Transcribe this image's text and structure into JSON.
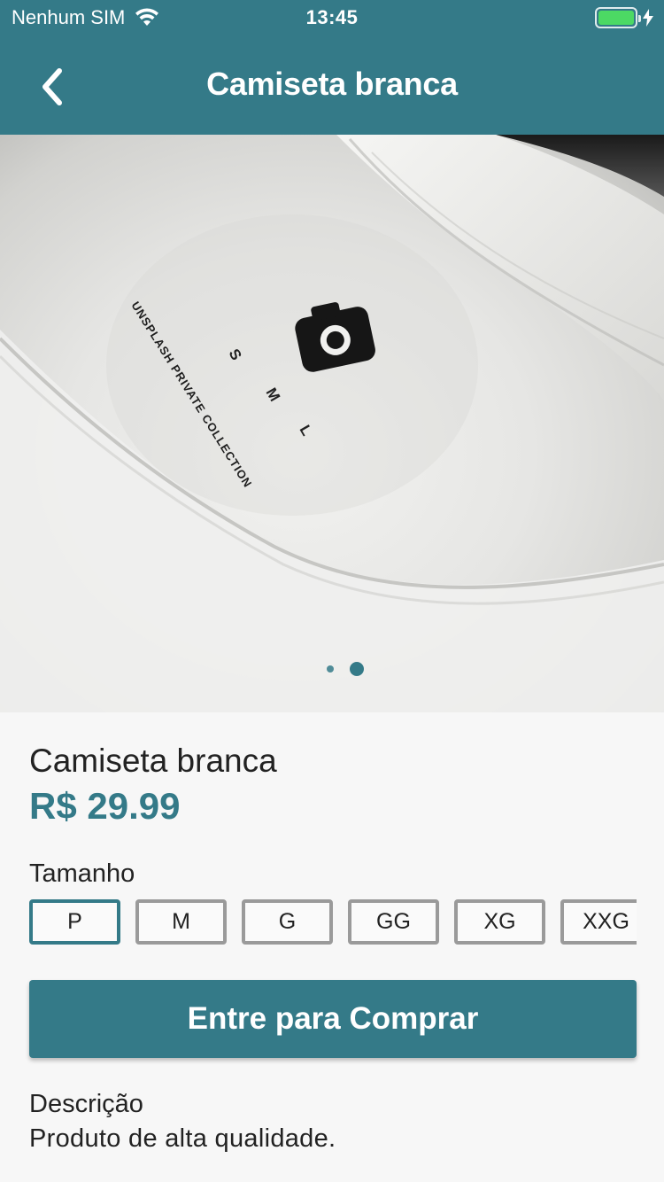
{
  "status_bar": {
    "carrier": "Nenhum SIM",
    "time": "13:45",
    "battery_level": 1.0,
    "battery_color": "#4cd964"
  },
  "app_bar": {
    "back_icon": "chevron-left-icon",
    "title": "Camiseta branca",
    "background": "#347a88"
  },
  "carousel": {
    "image": "white t-shirt with neck label",
    "label_sizes": [
      "S",
      "M",
      "L"
    ],
    "label_text": "UNSPLASH PRIVATE COLLECTION",
    "page_count": 2,
    "active_page": 2
  },
  "product": {
    "name": "Camiseta branca",
    "price": "R$ 29.99",
    "size_label": "Tamanho",
    "sizes": [
      "P",
      "M",
      "G",
      "GG",
      "XG",
      "XXG"
    ],
    "selected_size": "P",
    "buy_label": "Entre para Comprar",
    "description_title": "Descrição",
    "description": "Produto de alta qualidade."
  }
}
